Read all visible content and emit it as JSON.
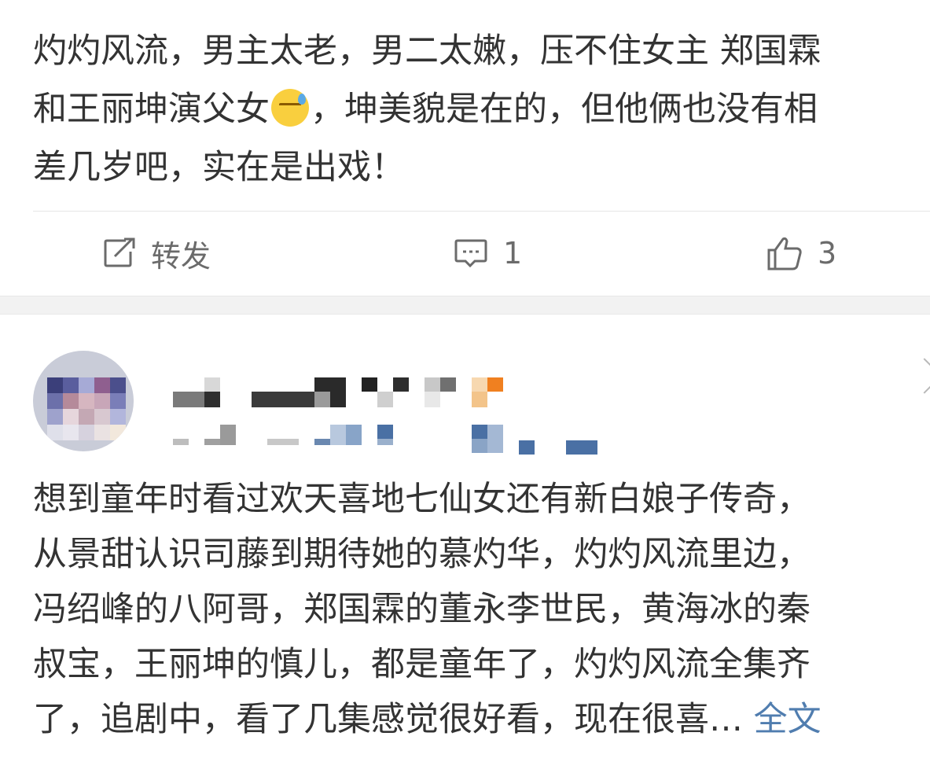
{
  "post1": {
    "line1": "灼灼风流，男主太老，男二太嫩，压不住女主 郑国霖",
    "line2_before_emoji": "和王丽坤演父女",
    "emoji": "sweat-face-emoji",
    "line2_after_emoji": "，坤美貌是在的，但他俩也没有相",
    "line3": "差几岁吧，实在是出戏！"
  },
  "actions": {
    "repost_label": "转发",
    "comment_count": "1",
    "like_count": "3"
  },
  "post2": {
    "lines": [
      "想到童年时看过欢天喜地七仙女还有新白娘子传奇，",
      "从景甜认识司藤到期待她的慕灼华，灼灼风流里边，",
      "冯绍峰的八阿哥，郑国霖的董永李世民，黄海冰的秦",
      "叔宝，王丽坤的慎儿，都是童年了，灼灼风流全集齐"
    ],
    "last_line": "了，追剧中，看了几集感觉很好看，现在很喜… ",
    "full_text_link": "全文"
  },
  "colors": {
    "text": "#333333",
    "action_gray": "#6b6b6b",
    "link_blue": "#507daf",
    "separator_band": "#f2f2f2"
  }
}
